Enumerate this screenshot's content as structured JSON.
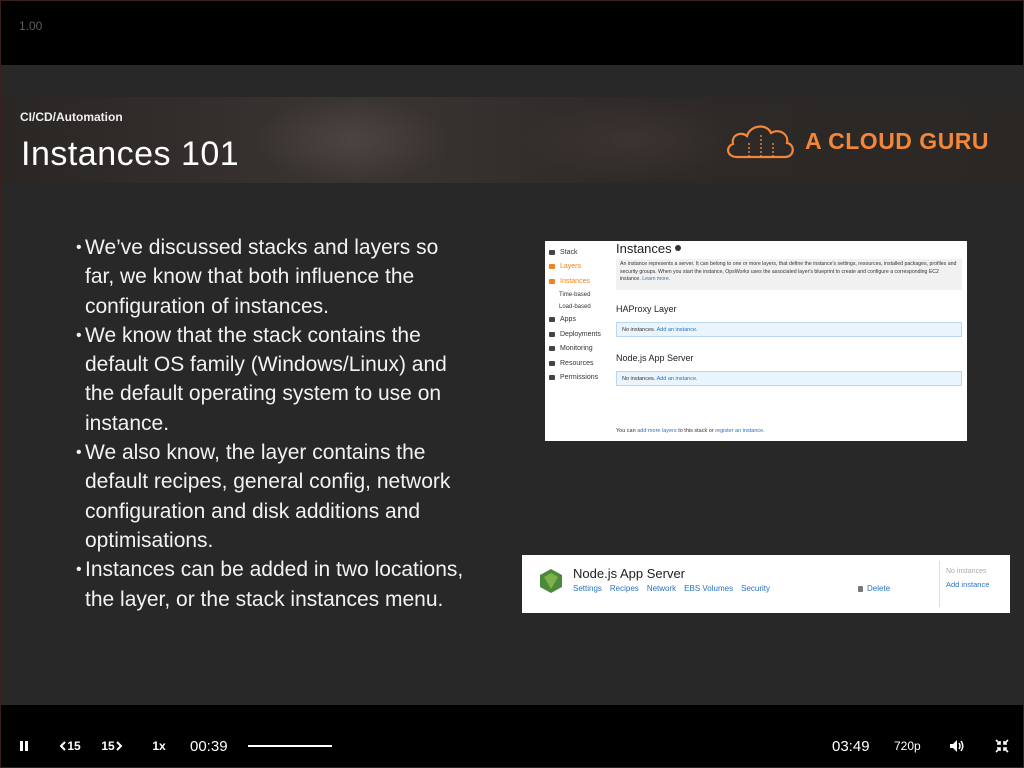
{
  "player": {
    "speed_indicator": "1.00",
    "controls": {
      "rewind_label": "15",
      "forward_label": "15",
      "speed_label": "1x",
      "current_time": "00:39",
      "total_time": "03:49",
      "quality_label": "720p",
      "progress_fraction": 0.17
    }
  },
  "slide": {
    "category": "CI/CD/Automation",
    "title": "Instances 101",
    "brand": "A CLOUD GURU",
    "brand_color": "#f4863a",
    "bullets": [
      [
        "We’ve discussed stacks and layers so",
        "far, we know that both influence the",
        "configuration of instances."
      ],
      [
        "We know that the stack contains the",
        "default OS family (Windows/Linux) and",
        "the default operating system to use on",
        "instance."
      ],
      [
        "We also know, the layer contains the",
        "default recipes, general config, network",
        "configuration and disk additions and",
        "optimisations."
      ],
      [
        "Instances can be added in two locations,",
        "the layer, or the stack instances menu."
      ]
    ]
  },
  "screenshot_instances": {
    "sidebar": [
      "Stack",
      "Layers",
      "Instances",
      "Time-based",
      "Load-based",
      "Apps",
      "Deployments",
      "Monitoring",
      "Resources",
      "Permissions"
    ],
    "heading": "Instances",
    "description": "An instance represents a server. It can belong to one or more layers, that define the instance's settings, resources, installed packages, profiles and security groups. When you start the instance, OpsWorks uses the associated layer's blueprint to create and configure a corresponding EC2 instance.",
    "learn_more": "Learn more.",
    "layers": [
      {
        "name": "HAProxy Layer",
        "no_instances": "No instances.",
        "add_link": "Add an instance."
      },
      {
        "name": "Node.js App Server",
        "no_instances": "No instances.",
        "add_link": "Add an instance."
      }
    ],
    "footer_prefix": "You can",
    "footer_link1": "add more layers",
    "footer_mid": "to this stack or",
    "footer_link2": "register an instance",
    "footer_end": "."
  },
  "screenshot_layer": {
    "name": "Node.js App Server",
    "links": [
      "Settings",
      "Recipes",
      "Network",
      "EBS Volumes",
      "Security"
    ],
    "delete_label": "Delete",
    "no_instances": "No instances",
    "add_instance": "Add instance"
  }
}
